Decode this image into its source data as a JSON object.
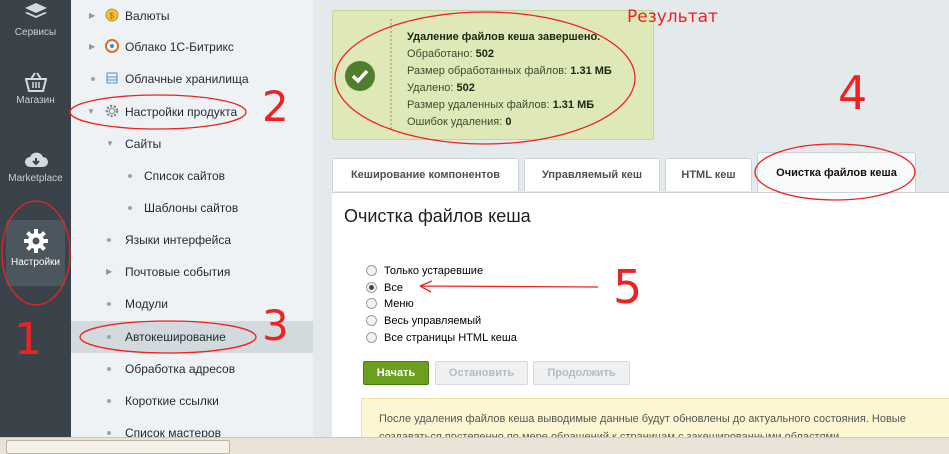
{
  "rail": {
    "items": [
      {
        "label": "Сервисы",
        "icon": "layers-icon"
      },
      {
        "label": "Магазин",
        "icon": "basket-icon"
      },
      {
        "label": "Marketplace",
        "icon": "cloud-download-icon"
      },
      {
        "label": "Настройки",
        "icon": "gear-icon"
      }
    ]
  },
  "tree": {
    "items": [
      {
        "label": "Валюты"
      },
      {
        "label": "Облако 1С-Битрикс"
      },
      {
        "label": "Облачные хранилища"
      },
      {
        "label": "Настройки продукта"
      },
      {
        "label": "Сайты"
      },
      {
        "label": "Список сайтов"
      },
      {
        "label": "Шаблоны сайтов"
      },
      {
        "label": "Языки интерфейса"
      },
      {
        "label": "Почтовые события"
      },
      {
        "label": "Модули"
      },
      {
        "label": "Автокеширование"
      },
      {
        "label": "Обработка адресов"
      },
      {
        "label": "Короткие ссылки"
      },
      {
        "label": "Список мастеров"
      }
    ]
  },
  "result": {
    "title": "Удаление файлов кеша завершено.",
    "processed_label": "Обработано:",
    "processed_value": "502",
    "processed_size_label": "Размер обработанных файлов:",
    "processed_size_value": "1.31 МБ",
    "deleted_label": "Удалено:",
    "deleted_value": "502",
    "deleted_size_label": "Размер удаленных файлов:",
    "deleted_size_value": "1.31 МБ",
    "errors_label": "Ошибок удаления:",
    "errors_value": "0"
  },
  "tabs": [
    {
      "label": "Кеширование компонентов"
    },
    {
      "label": "Управляемый кеш"
    },
    {
      "label": "HTML кеш"
    },
    {
      "label": "Очистка файлов кеша"
    }
  ],
  "panel": {
    "title": "Очистка файлов кеша",
    "options": [
      {
        "label": "Только устаревшие",
        "checked": false
      },
      {
        "label": "Все",
        "checked": true
      },
      {
        "label": "Меню",
        "checked": false
      },
      {
        "label": "Весь управляемый",
        "checked": false
      },
      {
        "label": "Все страницы HTML кеша",
        "checked": false
      }
    ],
    "buttons": {
      "start": "Начать",
      "stop": "Остановить",
      "continue": "Продолжить"
    },
    "info_line1": "После удаления файлов кеша выводимые данные будут обновлены до актуального состояния. Новые",
    "info_line2": "создаваться постепенно по мере обращений к страницам с закешированными областями."
  },
  "annotations": {
    "result_label": "Результат",
    "n1": "1",
    "n2": "2",
    "n3": "3",
    "n4": "4",
    "n5": "5"
  },
  "colors": {
    "accent_green": "#5c9b1f",
    "annotation_red": "#e22222"
  }
}
